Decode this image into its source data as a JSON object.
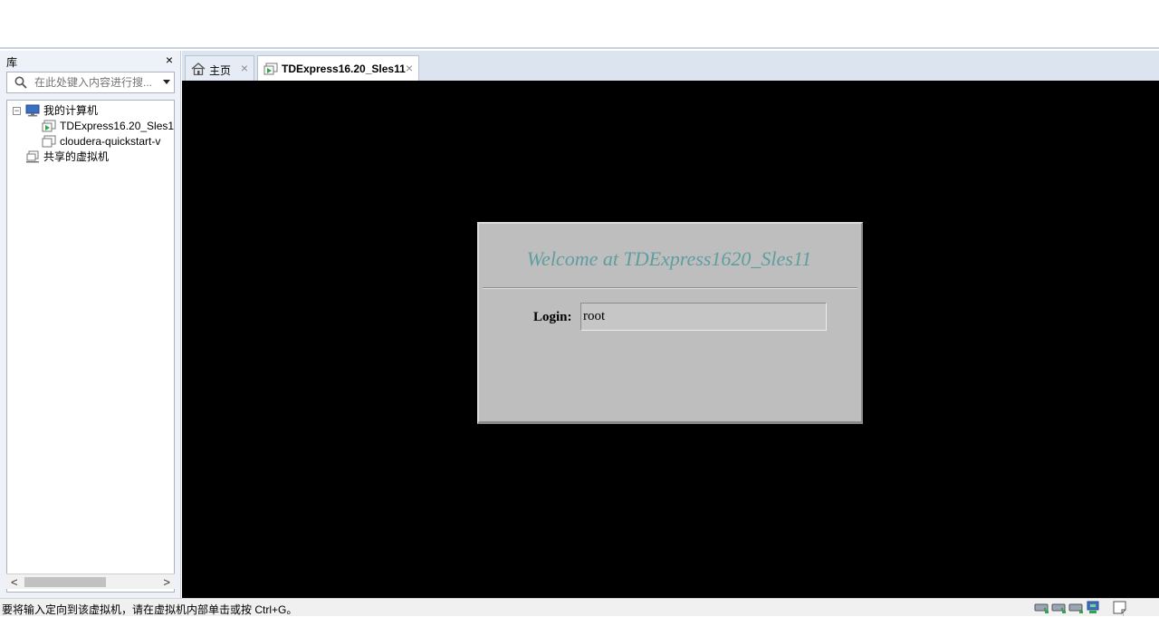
{
  "library": {
    "title": "库",
    "close_label": "×",
    "search_placeholder": "在此处键入内容进行搜..."
  },
  "tree": {
    "root_label": "我的计算机",
    "root_expander": "⊟",
    "items": [
      {
        "label": "TDExpress16.20_Sles1"
      },
      {
        "label": "cloudera-quickstart-v"
      }
    ],
    "shared_label": "共享的虚拟机"
  },
  "scrollbar": {
    "left_arrow": "<",
    "right_arrow": ">"
  },
  "tabs": [
    {
      "label": "主页",
      "close": "×"
    },
    {
      "label": "TDExpress16.20_Sles11",
      "close": "×"
    }
  ],
  "vm": {
    "welcome": "Welcome at TDExpress1620_Sles11",
    "login_label": "Login:",
    "login_value": "root"
  },
  "status": {
    "text": "要将输入定向到该虚拟机，请在虚拟机内部单击或按 Ctrl+G。"
  },
  "colors": {
    "welcome_text": "#5f9ea0",
    "vm_background": "#000000",
    "dialog_background": "#bebebe"
  },
  "icons": [
    "search-icon",
    "computer-icon",
    "vm-running-icon",
    "vm-icon",
    "shared-vm-icon",
    "home-icon",
    "hdd-icon",
    "network-icon",
    "message-icon"
  ]
}
